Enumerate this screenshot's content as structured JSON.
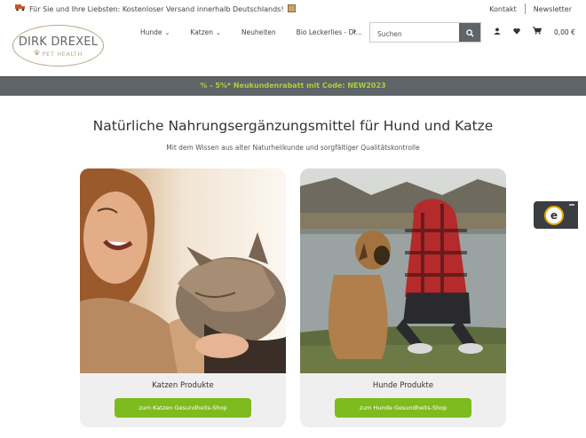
{
  "topbar": {
    "promo_icon": "truck-icon",
    "promo_text": "Für Sie und Ihre Liebsten: Kostenloser Versand innerhalb Deutschlands!",
    "links": [
      "Kontakt",
      "Newsletter"
    ]
  },
  "logo": {
    "name": "DIRK DREXEL",
    "sub": "PET HEALTH"
  },
  "nav": {
    "items": [
      "Hunde",
      "Katzen",
      "Neuheiten",
      "Bio Leckerlies - Dr..."
    ]
  },
  "search": {
    "placeholder": "Suchen"
  },
  "cart": {
    "price": "0,00 €"
  },
  "banner": {
    "text": "% - 5%* Neukundenrabatt mit Code: NEW2023"
  },
  "hero": {
    "title": "Natürliche Nahrungsergänzungsmittel für Hund und Katze",
    "subtitle": "Mit dem Wissen aus alter Naturheilkunde und sorgfältiger Qualitätskontrolle"
  },
  "cards": [
    {
      "title": "Katzen Produkte",
      "button": "zum Katzen Gesundheits-Shop"
    },
    {
      "title": "Hunde Produkte",
      "button": "zum Hunde Gesundheits-Shop"
    }
  ],
  "trust_badge": {
    "letter": "e"
  },
  "colors": {
    "accent_green": "#7dbb1e",
    "banner_bg": "#5f6468",
    "banner_text": "#a6d33b",
    "logo_gold": "#b9a582"
  }
}
